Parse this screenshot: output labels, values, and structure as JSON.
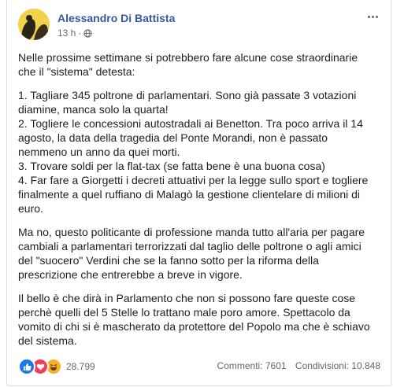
{
  "post": {
    "author": "Alessandro Di Battista",
    "time": "13 h",
    "privacy_icon": "globe-icon",
    "paragraphs": [
      {
        "lines": [
          "Nelle prossime settimane si potrebbero fare alcune cose straordinarie",
          "che il \"sistema\" detesta:"
        ]
      },
      {
        "lines": [
          "1. Tagliare 345 poltrone di parlamentari. Sono già passate 3 votazioni",
          "diamine, manca solo la quarta!",
          "2. Togliere le concessioni autostradali ai Benetton. Tra poco arriva il 14",
          "agosto, la data della tragedia del Ponte Morandi, non è passato",
          "nemmeno un anno da quei morti.",
          "3. Trovare soldi per la flat-tax (se fatta bene è una buona cosa)",
          "4. Far fare a Giorgetti i decreti attuativi per la legge sullo sport e togliere",
          "finalmente a quel ruffiano di Malagò la gestione clientelare di milioni di",
          "euro."
        ]
      },
      {
        "lines": [
          "Ma no, questo politicante di professione manda tutto all'aria per pagare",
          "cambiali a parlamentari terrorizzati dal taglio delle poltrone o agli amici",
          "del \"suocero\" Verdini che se la fanno sotto per la riforma della",
          "prescrizione che entrerebbe a breve in vigore."
        ]
      },
      {
        "lines": [
          "Il bello è che dirà in Parlamento che non si possono fare queste cose",
          "perchè quelli del 5 Stelle lo trattano male poro amore. Spettacolo da",
          "vomito di chi si è mascherato da protettore del Popolo ma che è schiavo",
          "del sistema."
        ]
      }
    ]
  },
  "footer": {
    "reactions": [
      "like-icon",
      "love-icon",
      "haha-icon"
    ],
    "reaction_count": "28.799",
    "comments": "Commenti: 7601",
    "shares": "Condivisioni: 10.848"
  },
  "colors": {
    "author_link": "#385898",
    "meta_text": "#616770",
    "like": "#1877f2",
    "love": "#f33e58",
    "haha": "#f7b125"
  }
}
